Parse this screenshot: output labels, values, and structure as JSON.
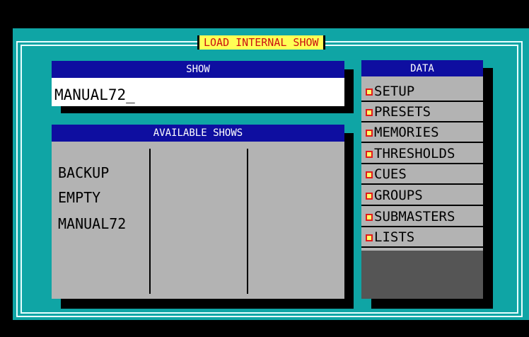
{
  "window": {
    "title": "LOAD INTERNAL SHOW"
  },
  "show": {
    "header": "SHOW",
    "value": "MANUAL72_"
  },
  "available_shows": {
    "header": "AVAILABLE SHOWS",
    "items": [
      "BACKUP",
      "EMPTY",
      "MANUAL72"
    ]
  },
  "data": {
    "header": "DATA",
    "items": [
      "SETUP",
      "PRESETS",
      "MEMORIES",
      "THRESHOLDS",
      "CUES",
      "GROUPS",
      "SUBMASTERS",
      "LISTS"
    ]
  },
  "colors": {
    "background": "#0fa5a5",
    "header": "#0e0ea0",
    "title_bg": "#ffff55",
    "title_text": "#cc1111",
    "panel": "#b3b3b3"
  }
}
